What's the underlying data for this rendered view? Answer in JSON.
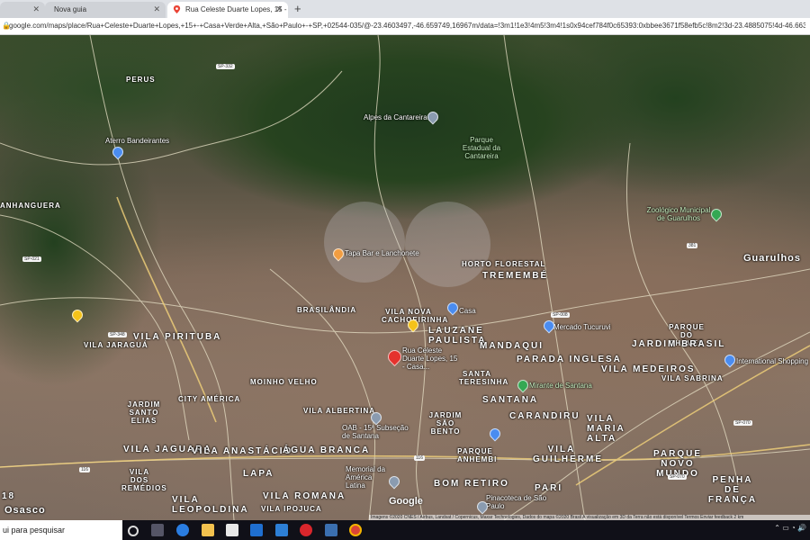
{
  "browser": {
    "tabs": [
      {
        "label": "Nova guia",
        "active": false
      },
      {
        "label": "Nova guia",
        "active": false
      },
      {
        "label": "Rua Celeste Duarte Lopes, 15 - C...",
        "active": true
      }
    ],
    "new_tab_symbol": "+",
    "url": "google.com/maps/place/Rua+Celeste+Duarte+Lopes,+15+-+Casa+Verde+Alta,+São+Paulo+-+SP,+02544-035/@-23.4603497,-46.659749,16967m/data=!3m1!1e3!4m5!3m4!1s0x94cef784f0c65393:0xbbee3671f58efb5c!8m2!3d-23.4885075!4d-46.6633698"
  },
  "map": {
    "labels": [
      {
        "text": "PERUS",
        "style": "district"
      },
      {
        "text": "Alpes da Cantareira",
        "style": "plain"
      },
      {
        "text": "Parque Estadual da Cantareira",
        "style": "green"
      },
      {
        "text": "Aterro Bandeirantes",
        "style": "plain"
      },
      {
        "text": "ANHANGUERA",
        "style": "district"
      },
      {
        "text": "Zoológico Municipal de Guarulhos",
        "style": "green"
      },
      {
        "text": "Guarulhos",
        "style": "city"
      },
      {
        "text": "Tapa Bar e Lanchonete",
        "style": "plain"
      },
      {
        "text": "HORTO FLORESTAL",
        "style": "district"
      },
      {
        "text": "TREMEMBÉ",
        "style": "big"
      },
      {
        "text": "BRASILÂNDIA",
        "style": "district"
      },
      {
        "text": "VILA NOVA CACHOEIRINHA",
        "style": "district"
      },
      {
        "text": "Casa",
        "style": "plain"
      },
      {
        "text": "Mercado Tucuruvi",
        "style": "plain"
      },
      {
        "text": "PARQUE DO CHAVES",
        "style": "district"
      },
      {
        "text": "VILA PIRITUBA",
        "style": "big"
      },
      {
        "text": "VILA JARAGUÁ",
        "style": "district"
      },
      {
        "text": "LAUZANE PAULISTA",
        "style": "big"
      },
      {
        "text": "MANDAQUI",
        "style": "big"
      },
      {
        "text": "JARDIM BRASIL",
        "style": "big"
      },
      {
        "text": "Rua Celeste Duarte Lopes, 15 - Casa...",
        "style": "plain"
      },
      {
        "text": "PARADA INGLESA",
        "style": "big"
      },
      {
        "text": "VILA MEDEIROS",
        "style": "big"
      },
      {
        "text": "International Shopping",
        "style": "plain"
      },
      {
        "text": "MOINHO VELHO",
        "style": "district"
      },
      {
        "text": "SANTA TERESINHA",
        "style": "district"
      },
      {
        "text": "Mirante de Santana",
        "style": "green"
      },
      {
        "text": "VILA SABRINA",
        "style": "district"
      },
      {
        "text": "CITY AMÉRICA",
        "style": "district"
      },
      {
        "text": "SANTANA",
        "style": "big"
      },
      {
        "text": "JARDIM SANTO ELIAS",
        "style": "district"
      },
      {
        "text": "VILA ALBERTINA",
        "style": "district"
      },
      {
        "text": "CARANDIRU",
        "style": "big"
      },
      {
        "text": "VILA MARIA ALTA",
        "style": "big"
      },
      {
        "text": "OAB - 15ª Subseção de Santana",
        "style": "plain"
      },
      {
        "text": "JARDIM SÃO BENTO",
        "style": "district"
      },
      {
        "text": "VILA JAGUARA",
        "style": "big"
      },
      {
        "text": "VILA ANASTÁCIO",
        "style": "big"
      },
      {
        "text": "ÁGUA BRANCA",
        "style": "big"
      },
      {
        "text": "PARQUE ANHEMBI",
        "style": "district"
      },
      {
        "text": "VILA GUILHERME",
        "style": "big"
      },
      {
        "text": "PARQUE NOVO MUNDO",
        "style": "big"
      },
      {
        "text": "VILA DOS REMÉDIOS",
        "style": "district"
      },
      {
        "text": "LAPA",
        "style": "big"
      },
      {
        "text": "Memorial da América Latina",
        "style": "plain"
      },
      {
        "text": "BOM RETIRO",
        "style": "big"
      },
      {
        "text": "PARI",
        "style": "big"
      },
      {
        "text": "PENHA DE FRANÇA",
        "style": "big"
      },
      {
        "text": "VILA LEOPOLDINA",
        "style": "big"
      },
      {
        "text": "VILA ROMANA",
        "style": "big"
      },
      {
        "text": "VILA IPOJUCA",
        "style": "district"
      },
      {
        "text": "Pinacoteca de São Paulo",
        "style": "plain"
      },
      {
        "text": "18",
        "style": "big"
      },
      {
        "text": "Osasco",
        "style": "city"
      }
    ],
    "shields": [
      "SP-332",
      "SP-021",
      "SP-348",
      "SP-008",
      "381",
      "SP-070",
      "SP-070",
      "116",
      "116"
    ],
    "logo": "Google",
    "attribution": "Imagens ©2020 CNES / Airbus, Landsat / Copernicus, Maxar Technologies, Dados do mapa ©2020   Brasil   A visualização em 3D da Terra não está disponível   Termos   Enviar feedback   2 km"
  },
  "taskbar": {
    "search_placeholder": "ui para pesquisar"
  }
}
